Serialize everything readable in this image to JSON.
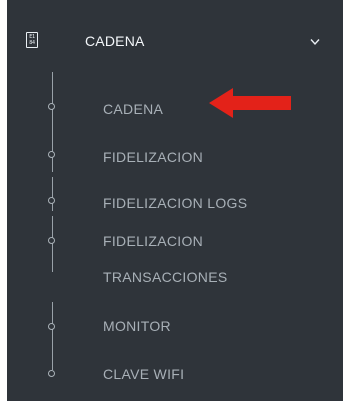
{
  "menu": {
    "header": {
      "icon_name": "module-grid-icon",
      "icon_text": "E1 84",
      "label": "CADENA",
      "chevron_icon": "chevron-down-icon"
    },
    "items": [
      {
        "label": "CADENA",
        "highlighted": true
      },
      {
        "label": "FIDELIZACION"
      },
      {
        "label": "FIDELIZACION LOGS"
      },
      {
        "label": "FIDELIZACION TRANSACCIONES"
      },
      {
        "label": "MONITOR"
      },
      {
        "label": "CLAVE WIFI"
      }
    ]
  },
  "annotation": {
    "icon_name": "red-arrow-icon",
    "color": "#e32219"
  },
  "colors": {
    "panel_bg": "#2f343a",
    "header_text": "#f4f7fa",
    "item_text": "#a8b0b7",
    "tree_line": "#99a1a8"
  }
}
